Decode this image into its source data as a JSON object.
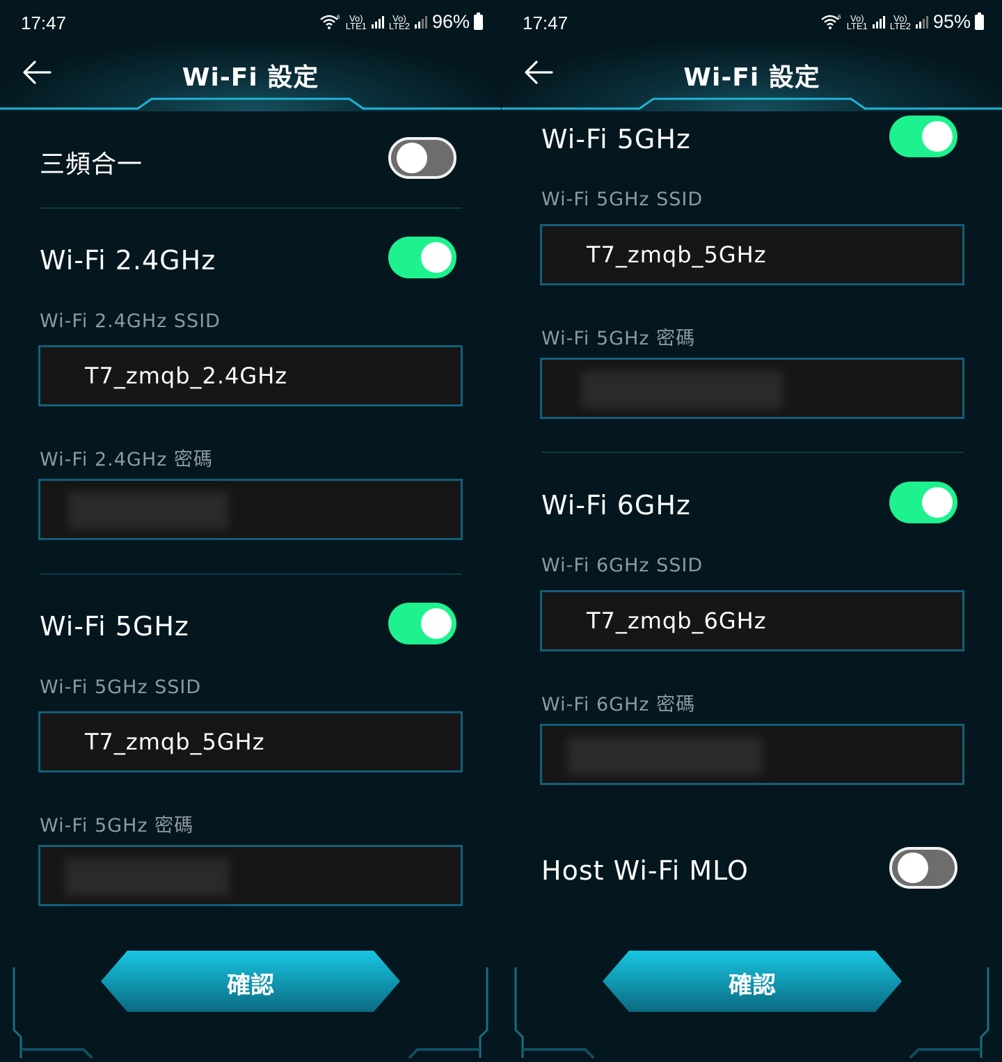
{
  "left": {
    "status": {
      "time": "17:47",
      "battery": "96%",
      "net1": "LTE1",
      "net2": "LTE2"
    },
    "header": {
      "title": "Wi-Fi 設定"
    },
    "tri_band": {
      "label": "三頻合一",
      "enabled": false
    },
    "wifi24": {
      "label": "Wi-Fi 2.4GHz",
      "enabled": true,
      "ssid_label": "Wi-Fi 2.4GHz SSID",
      "ssid_value": "T7_zmqb_2.4GHz",
      "password_label": "Wi-Fi 2.4GHz 密碼"
    },
    "wifi5": {
      "label": "Wi-Fi 5GHz",
      "enabled": true,
      "ssid_label": "Wi-Fi 5GHz SSID",
      "ssid_value": "T7_zmqb_5GHz",
      "password_label": "Wi-Fi 5GHz 密碼"
    },
    "confirm_label": "確認"
  },
  "right": {
    "status": {
      "time": "17:47",
      "battery": "95%",
      "net1": "LTE1",
      "net2": "LTE2"
    },
    "header": {
      "title": "Wi-Fi 設定"
    },
    "wifi5": {
      "label": "Wi-Fi 5GHz",
      "enabled": true,
      "ssid_label": "Wi-Fi 5GHz SSID",
      "ssid_value": "T7_zmqb_5GHz",
      "password_label": "Wi-Fi 5GHz 密碼"
    },
    "wifi6": {
      "label": "Wi-Fi 6GHz",
      "enabled": true,
      "ssid_label": "Wi-Fi 6GHz SSID",
      "ssid_value": "T7_zmqb_6GHz",
      "password_label": "Wi-Fi 6GHz 密碼"
    },
    "mlo": {
      "label": "Host Wi-Fi MLO",
      "enabled": false
    },
    "confirm_label": "確認"
  },
  "colors": {
    "background": "#04171e",
    "toggle_on": "#1ef28e",
    "toggle_off": "#6d6d6d",
    "field_border": "#135f79",
    "button_top": "#16c3e0",
    "button_bottom": "#0a6e85"
  },
  "icons": [
    "back-arrow-icon",
    "wifi-6-icon",
    "signal-icon",
    "battery-icon"
  ]
}
